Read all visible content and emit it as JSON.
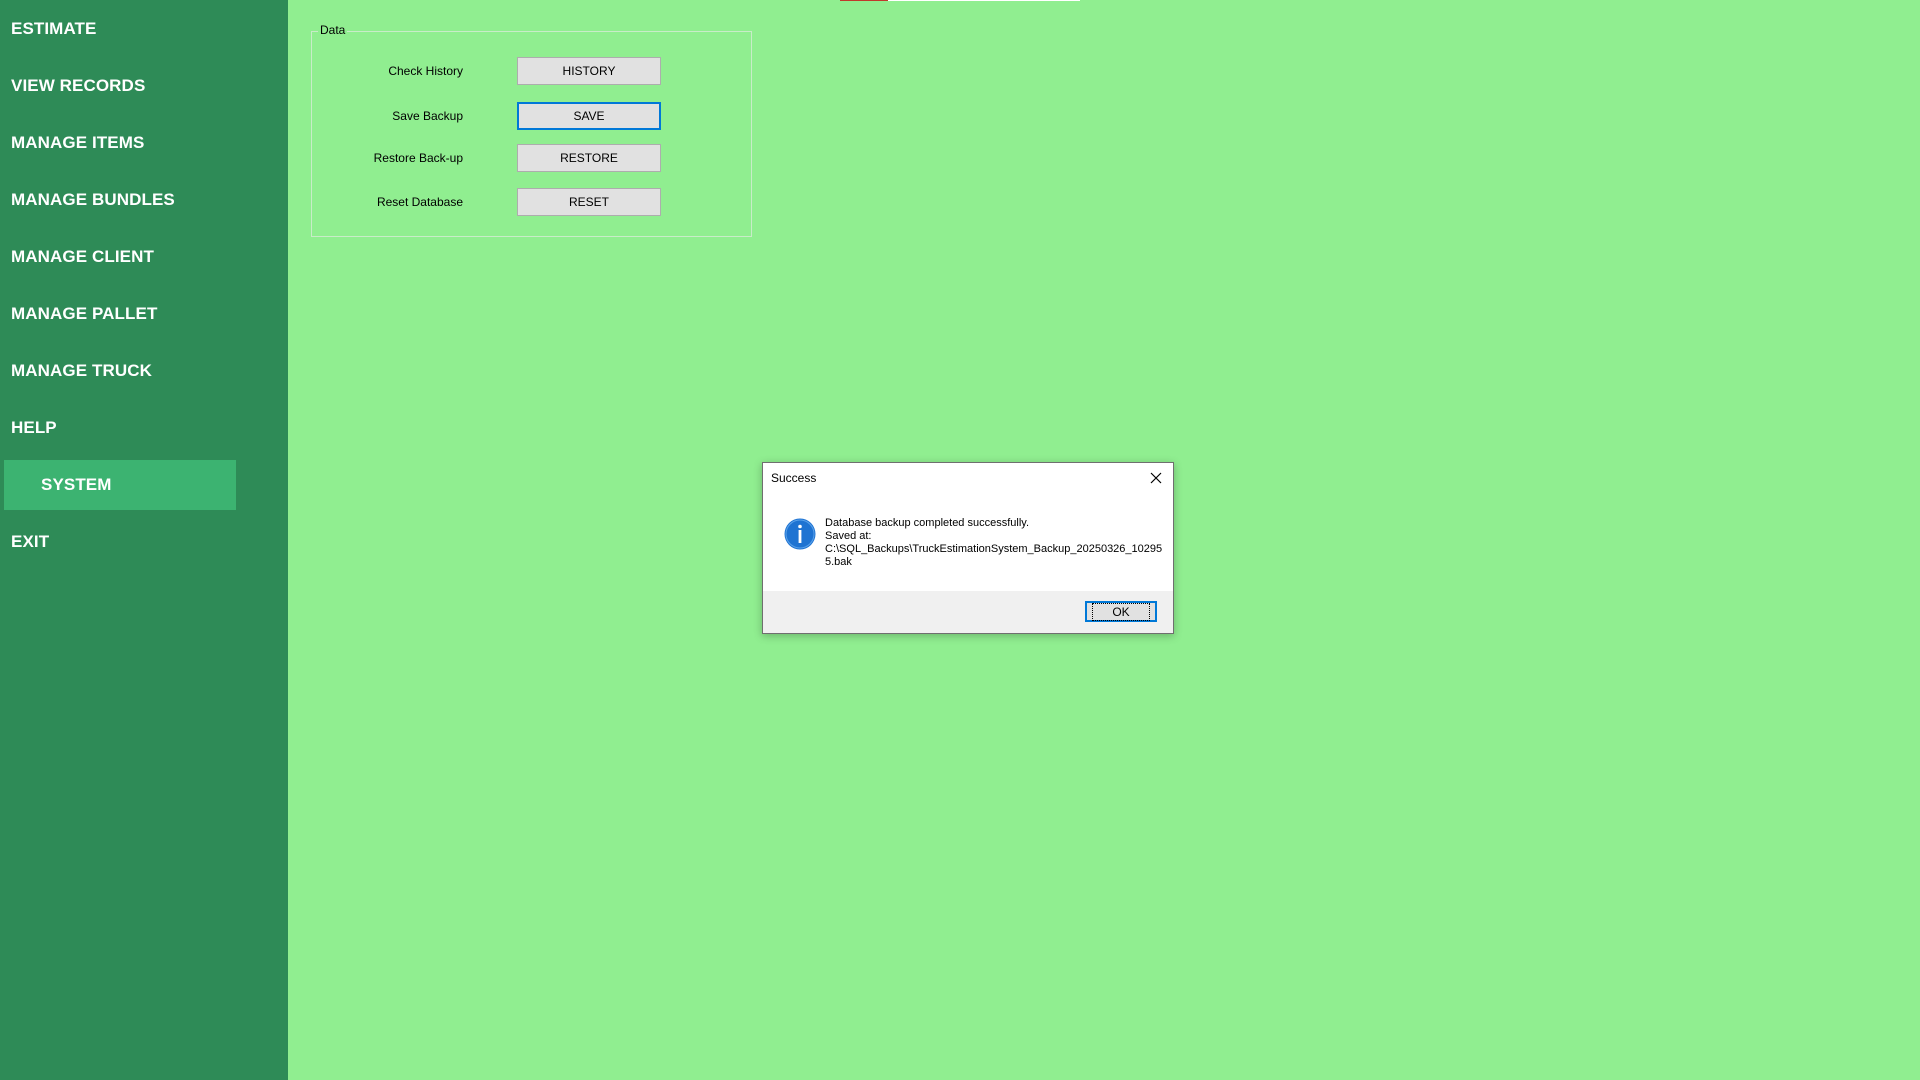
{
  "sidebar": {
    "items": [
      {
        "label": "ESTIMATE"
      },
      {
        "label": "VIEW RECORDS"
      },
      {
        "label": "MANAGE ITEMS"
      },
      {
        "label": "MANAGE BUNDLES"
      },
      {
        "label": "MANAGE CLIENT"
      },
      {
        "label": "MANAGE PALLET"
      },
      {
        "label": "MANAGE TRUCK"
      },
      {
        "label": "HELP"
      },
      {
        "label": "SYSTEM",
        "active": true
      },
      {
        "label": "EXIT"
      }
    ]
  },
  "data_group": {
    "legend": "Data",
    "rows": [
      {
        "label": "Check History",
        "button": "HISTORY"
      },
      {
        "label": "Save Backup",
        "button": "SAVE"
      },
      {
        "label": "Restore Back-up",
        "button": "RESTORE"
      },
      {
        "label": "Reset Database",
        "button": "RESET"
      }
    ]
  },
  "dialog": {
    "title": "Success",
    "message_line1": "Database backup completed successfully.",
    "message_line2": "Saved at:",
    "message_line3": "C:\\SQL_Backups\\TruckEstimationSystem_Backup_20250326_102955.bak",
    "ok_label": "OK",
    "icon": "info-icon",
    "close_icon": "close-icon"
  },
  "colors": {
    "background": "#90ee90",
    "sidebar": "#2e8b57",
    "sidebar_active": "#3cb371",
    "focus_border": "#0078d7"
  }
}
